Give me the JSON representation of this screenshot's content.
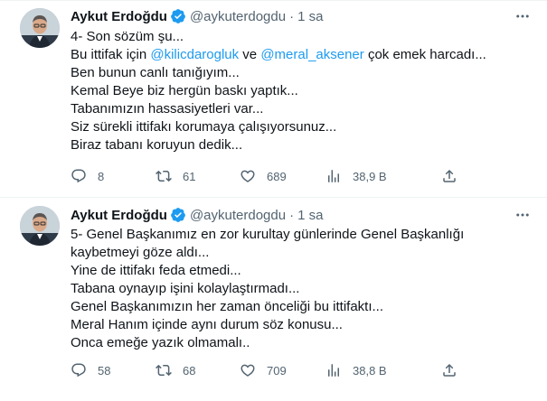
{
  "tweets": [
    {
      "author_name": "Aykut Erdoğdu",
      "handle": "@aykuterdogdu",
      "separator": "·",
      "time": "1 sa",
      "lines": [
        [
          {
            "text": "4- Son sözüm şu..."
          }
        ],
        [
          {
            "text": "Bu ittifak için "
          },
          {
            "text": "@kilicdarogluk",
            "mention": true
          },
          {
            "text": " ve "
          },
          {
            "text": "@meral_aksener",
            "mention": true
          },
          {
            "text": " çok emek harcadı..."
          }
        ],
        [
          {
            "text": "Ben bunun canlı tanığıyım..."
          }
        ],
        [
          {
            "text": "Kemal Beye biz hergün baskı yaptık..."
          }
        ],
        [
          {
            "text": "Tabanımızın hassasiyetleri var..."
          }
        ],
        [
          {
            "text": "Siz sürekli ittifakı korumaya çalışıyorsunuz..."
          }
        ],
        [
          {
            "text": "Biraz tabanı koruyun dedik..."
          }
        ]
      ],
      "replies": "8",
      "retweets": "61",
      "likes": "689",
      "views": "38,9 B"
    },
    {
      "author_name": "Aykut Erdoğdu",
      "handle": "@aykuterdogdu",
      "separator": "·",
      "time": "1 sa",
      "lines": [
        [
          {
            "text": "5- Genel Başkanımız en zor kurultay günlerinde Genel Başkanlığı"
          }
        ],
        [
          {
            "text": "kaybetmeyi göze aldı..."
          }
        ],
        [
          {
            "text": "Yine de ittifakı feda etmedi..."
          }
        ],
        [
          {
            "text": "Tabana oynayıp işini kolaylaştırmadı..."
          }
        ],
        [
          {
            "text": "Genel Başkanımızın her zaman önceliği bu ittifaktı..."
          }
        ],
        [
          {
            "text": "Meral Hanım içinde aynı durum söz konusu..."
          }
        ],
        [
          {
            "text": "Onca emeğe yazık olmamalı.."
          }
        ]
      ],
      "replies": "58",
      "retweets": "68",
      "likes": "709",
      "views": "38,8 B"
    }
  ],
  "colors": {
    "text": "#0f1419",
    "muted": "#536471",
    "accent": "#1d9bf0",
    "divider": "#eff3f4"
  },
  "icons": [
    "verified-badge-icon",
    "more-icon",
    "reply-icon",
    "retweet-icon",
    "like-icon",
    "views-icon",
    "share-icon"
  ]
}
